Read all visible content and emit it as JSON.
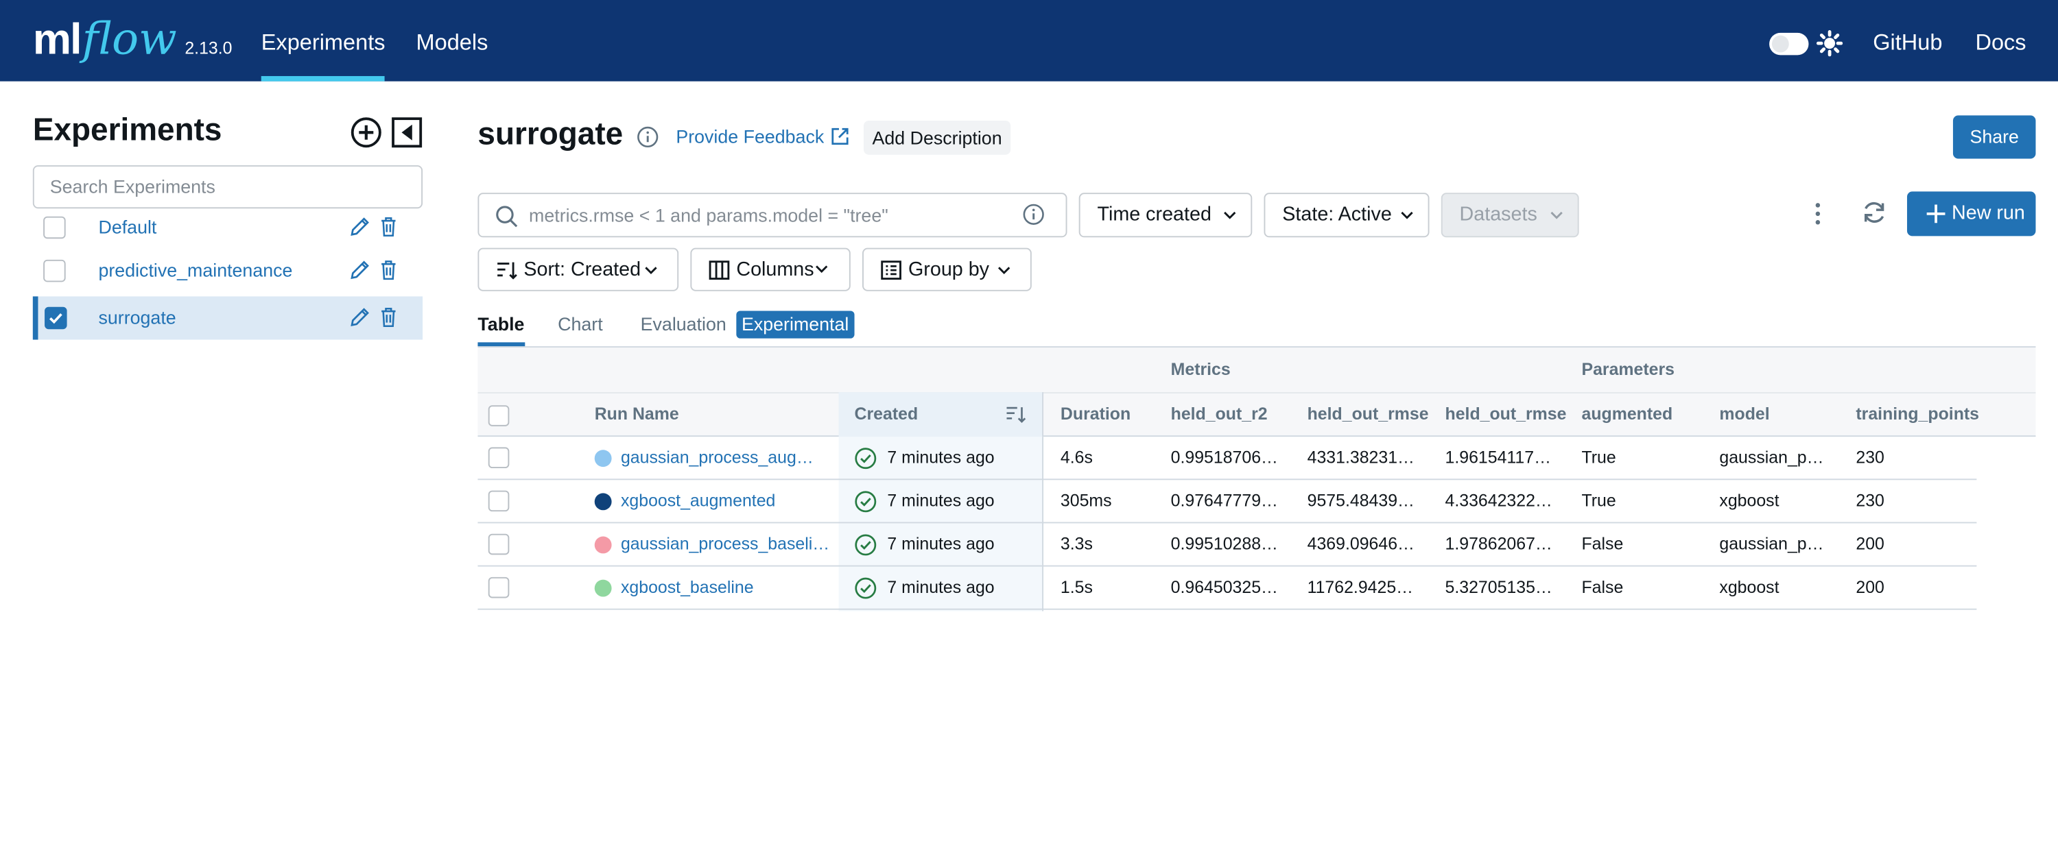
{
  "header": {
    "logo_ml": "ml",
    "logo_flow": "flow",
    "version": "2.13.0",
    "nav": [
      {
        "label": "Experiments",
        "active": true
      },
      {
        "label": "Models",
        "active": false
      }
    ],
    "right_links": [
      "GitHub",
      "Docs"
    ]
  },
  "sidebar": {
    "title": "Experiments",
    "search_placeholder": "Search Experiments",
    "experiments": [
      {
        "name": "Default",
        "selected": false
      },
      {
        "name": "predictive_maintenance",
        "selected": false
      },
      {
        "name": "surrogate",
        "selected": true
      }
    ]
  },
  "experiment": {
    "title": "surrogate",
    "feedback_label": "Provide Feedback",
    "add_description_label": "Add Description",
    "share_label": "Share"
  },
  "toolbar": {
    "filter_placeholder": "metrics.rmse < 1 and params.model = \"tree\"",
    "time_created_label": "Time created",
    "state_label": "State: Active",
    "datasets_label": "Datasets",
    "new_run_label": "New run",
    "sort_label": "Sort: Created",
    "columns_label": "Columns",
    "group_by_label": "Group by"
  },
  "tabs": [
    {
      "label": "Table",
      "active": true
    },
    {
      "label": "Chart",
      "active": false
    },
    {
      "label": "Evaluation",
      "active": false
    }
  ],
  "evaluation_badge": "Experimental",
  "table": {
    "groups": {
      "metrics": "Metrics",
      "parameters": "Parameters"
    },
    "columns": [
      "Run Name",
      "Created",
      "Duration",
      "held_out_r2",
      "held_out_rmse",
      "held_out_rmse_",
      "augmented",
      "model",
      "training_points"
    ],
    "rows": [
      {
        "color": "#8ec6f0",
        "run_name": "gaussian_process_augm…",
        "created": "7 minutes ago",
        "duration": "4.6s",
        "r2": "0.99518706…",
        "rmse": "4331.38231…",
        "rmse2": "1.96154117…",
        "augmented": "True",
        "model": "gaussian_p…",
        "training_points": "230"
      },
      {
        "color": "#10427a",
        "run_name": "xgboost_augmented",
        "created": "7 minutes ago",
        "duration": "305ms",
        "r2": "0.97647779…",
        "rmse": "9575.48439…",
        "rmse2": "4.33642322…",
        "augmented": "True",
        "model": "xgboost",
        "training_points": "230"
      },
      {
        "color": "#f49aa6",
        "run_name": "gaussian_process_baseline",
        "created": "7 minutes ago",
        "duration": "3.3s",
        "r2": "0.99510288…",
        "rmse": "4369.09646…",
        "rmse2": "1.97862067…",
        "augmented": "False",
        "model": "gaussian_p…",
        "training_points": "200"
      },
      {
        "color": "#8fd79e",
        "run_name": "xgboost_baseline",
        "created": "7 minutes ago",
        "duration": "1.5s",
        "r2": "0.96450325…",
        "rmse": "11762.9425…",
        "rmse2": "5.32705135…",
        "augmented": "False",
        "model": "xgboost",
        "training_points": "200"
      }
    ]
  }
}
